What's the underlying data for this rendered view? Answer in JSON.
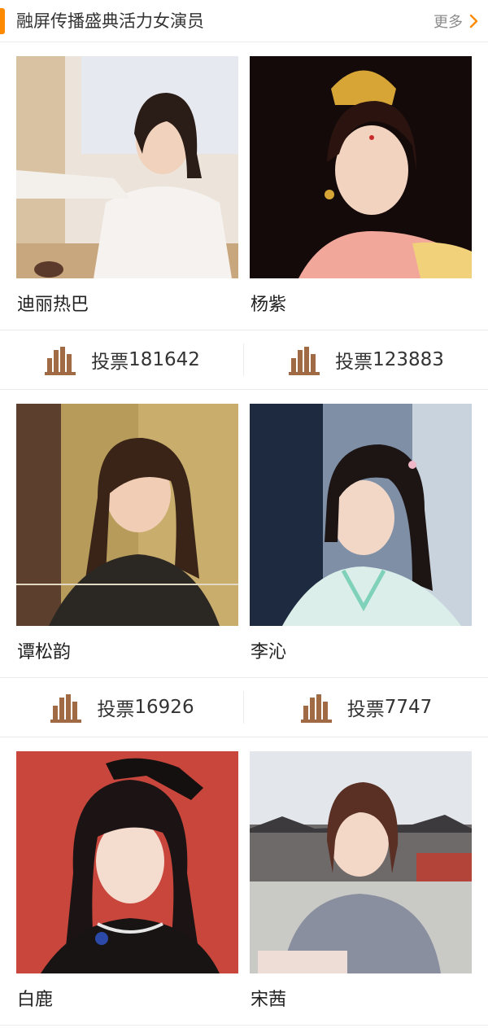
{
  "header": {
    "title": "融屏传播盛典活力女演员",
    "more_label": "更多",
    "accent_color": "#ff8a00"
  },
  "actresses": [
    {
      "name": "迪丽热巴",
      "vote_label": "投票",
      "votes": "181642",
      "photo_tone": "#e8e0d6"
    },
    {
      "name": "杨紫",
      "vote_label": "投票",
      "votes": "123883",
      "photo_tone": "#1c0d0d"
    },
    {
      "name": "谭松韵",
      "vote_label": "投票",
      "votes": "16926",
      "photo_tone": "#a88f52"
    },
    {
      "name": "李沁",
      "vote_label": "投票",
      "votes": "7747",
      "photo_tone": "#3a4a63"
    },
    {
      "name": "白鹿",
      "photo_tone": "#c8463c"
    },
    {
      "name": "宋茜",
      "photo_tone": "#dfe3e8"
    }
  ],
  "icons": {
    "more": "chevron-right-icon",
    "vote": "bar-chart-icon"
  },
  "colors": {
    "vote_icon": "#a06a45",
    "divider": "#ececec"
  }
}
